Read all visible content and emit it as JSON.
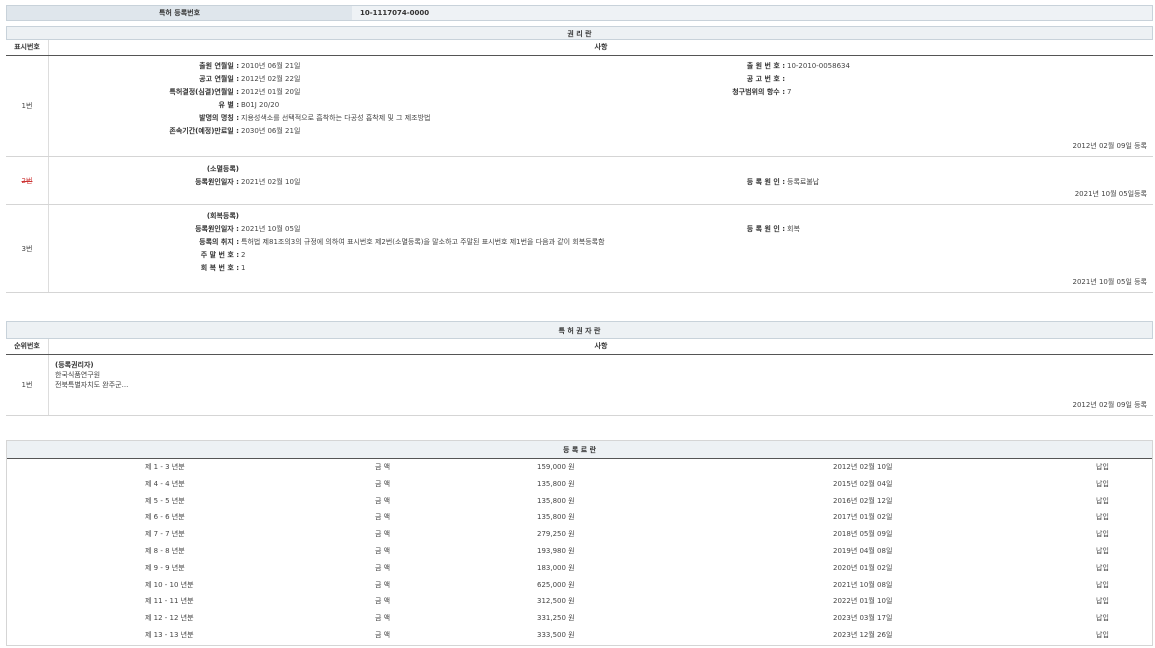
{
  "header": {
    "label": "특허 등록번호",
    "value": "10-1117074-0000"
  },
  "rights": {
    "title": "권 리 란",
    "col1": "표시번호",
    "col2": "사항",
    "rows": [
      {
        "num": "1번",
        "left": [
          {
            "k": "출원 연월일 :",
            "v": "2010년 06월 21일"
          },
          {
            "k": "공고 연월일 :",
            "v": "2012년 02월 22일"
          },
          {
            "k": "특허결정(심결)연월일 :",
            "v": "2012년 01월 20일"
          },
          {
            "k": "유 별 :",
            "v": "B01J 20/20"
          },
          {
            "k": "발명의 명칭 :",
            "v": "지용성색소를 선택적으로 흡착하는 다공성 흡착제 및 그 제조방법"
          },
          {
            "k": "존속기간(예정)만료일 :",
            "v": "2030년 06월 21일"
          }
        ],
        "right": [
          {
            "k": "출 원 번 호 :",
            "v": "10-2010-0058634"
          },
          {
            "k": "공 고 번 호 :",
            "v": ""
          },
          {
            "k": "청구범위의 항수 :",
            "v": "7"
          }
        ],
        "date": "2012년 02월 09일 등록"
      },
      {
        "num": "2번",
        "heading": "(소멸등록)",
        "left": [
          {
            "k": "등록원인일자 :",
            "v": "2021년 02월 10일"
          }
        ],
        "right": [
          {
            "k": "등 록 원 인 :",
            "v": "등록료불납"
          }
        ],
        "date": "2021년 10월 05일등록"
      },
      {
        "num": "3번",
        "heading": "(회복등록)",
        "left": [
          {
            "k": "등록원인일자 :",
            "v": "2021년 10월 05일"
          },
          {
            "k": "등록의 취지 :",
            "v": "특허법 제81조의3의 규정에 의하여 표시번호 제2번(소멸등록)을 말소하고 주말된 표시번호 제1번을 다음과 같이 회복등록함"
          },
          {
            "k": "주 말 번 호 :",
            "v": "2"
          },
          {
            "k": "회 복 번 호 :",
            "v": "1"
          }
        ],
        "right": [
          {
            "k": "등 록 원 인 :",
            "v": "회복"
          }
        ],
        "date": "2021년 10월 05일 등록"
      }
    ]
  },
  "holder": {
    "title": "특 허 권 자 란",
    "col1": "순위번호",
    "col2": "사항",
    "num": "1번",
    "lines": [
      "(등록권리자)",
      "한국식품연구원",
      "전북특별자치도 완주군..."
    ],
    "date": "2012년 02월 09일 등록"
  },
  "fees": {
    "title": "등 록 료 란",
    "amount_label": "금 액",
    "rows": [
      {
        "period": "제 1 - 3 년분",
        "amount": "159,000 원",
        "date": "2012년 02월 10일",
        "status": "납입"
      },
      {
        "period": "제 4 - 4 년분",
        "amount": "135,800 원",
        "date": "2015년 02월 04일",
        "status": "납입"
      },
      {
        "period": "제 5 - 5 년분",
        "amount": "135,800 원",
        "date": "2016년 02월 12일",
        "status": "납입"
      },
      {
        "period": "제 6 - 6 년분",
        "amount": "135,800 원",
        "date": "2017년 01월 02일",
        "status": "납입"
      },
      {
        "period": "제 7 - 7 년분",
        "amount": "279,250 원",
        "date": "2018년 05월 09일",
        "status": "납입"
      },
      {
        "period": "제 8 - 8 년분",
        "amount": "193,980 원",
        "date": "2019년 04월 08일",
        "status": "납입"
      },
      {
        "period": "제 9 - 9 년분",
        "amount": "183,000 원",
        "date": "2020년 01월 02일",
        "status": "납입"
      },
      {
        "period": "제 10 - 10 년분",
        "amount": "625,000 원",
        "date": "2021년 10월 08일",
        "status": "납입"
      },
      {
        "period": "제 11 - 11 년분",
        "amount": "312,500 원",
        "date": "2022년 01월 10일",
        "status": "납입"
      },
      {
        "period": "제 12 - 12 년분",
        "amount": "331,250 원",
        "date": "2023년 03월 17일",
        "status": "납입"
      },
      {
        "period": "제 13 - 13 년분",
        "amount": "333,500 원",
        "date": "2023년 12월 26일",
        "status": "납입"
      }
    ]
  }
}
